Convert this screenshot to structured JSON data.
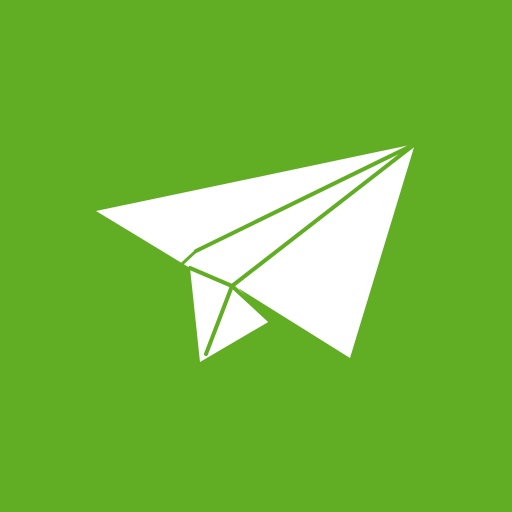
{
  "app_tile": {
    "icon": "paper-plane-icon",
    "background_color": "#61AE24",
    "foreground_color": "#FFFFFF"
  }
}
